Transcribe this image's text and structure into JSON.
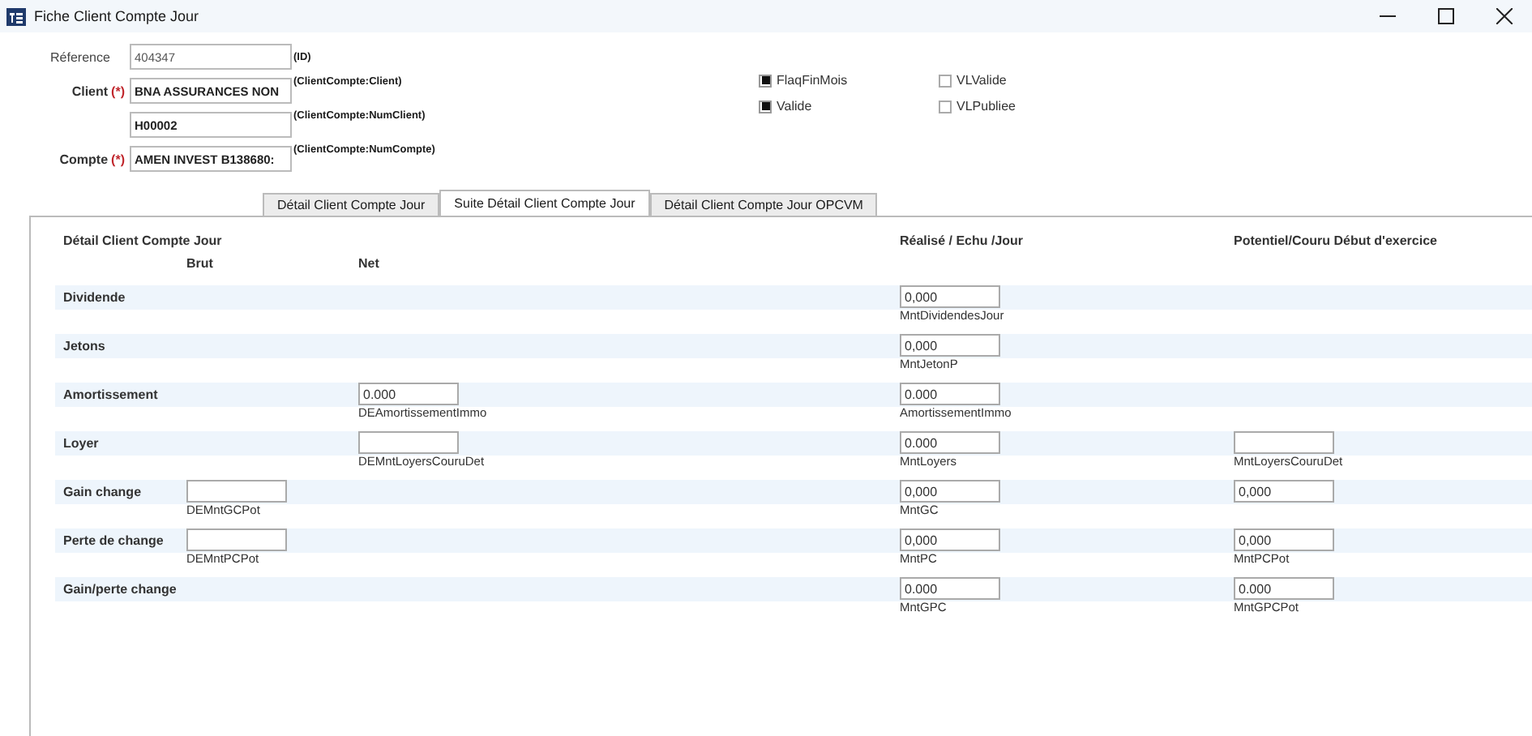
{
  "window": {
    "title": "Fiche Client Compte Jour"
  },
  "header_fields": [
    {
      "label": "Réference",
      "value": "404347",
      "tag": "(ID)"
    },
    {
      "label": "Client ",
      "required": "(*)",
      "value": "BNA ASSURANCES NON",
      "tag": "(ClientCompte:Client)"
    },
    {
      "value": "H00002",
      "tag": "(ClientCompte:NumClient)"
    },
    {
      "label": "Compte",
      "required": "(*)",
      "value": "AMEN INVEST B138680:",
      "tag": "(ClientCompte:NumCompte)"
    }
  ],
  "checkboxes": [
    {
      "label": "FlaqFinMois",
      "checked": true
    },
    {
      "label": "VLValide",
      "checked": false
    },
    {
      "label": "Valide",
      "checked": true
    },
    {
      "label": "VLPubliee",
      "checked": false
    }
  ],
  "tabs": [
    {
      "label": "Détail Client Compte Jour",
      "selected": false
    },
    {
      "label": "Suite Détail Client Compte Jour",
      "selected": true
    },
    {
      "label": "Détail Client Compte Jour OPCVM",
      "selected": false
    }
  ],
  "section_title": "Détail Client Compte Jour",
  "column_headers": {
    "brut": "Brut",
    "net": "Net",
    "realise": "Réalisé / Echu /Jour",
    "potentiel": "Potentiel/Couru Début d'exercice"
  },
  "rows": [
    {
      "label": "Dividende",
      "realise": {
        "value": "0,000",
        "caption": "MntDividendesJour"
      }
    },
    {
      "label": "Jetons",
      "realise": {
        "value": "0,000",
        "caption": "MntJetonP"
      }
    },
    {
      "label": "Amortissement",
      "net": {
        "value": "0.000",
        "caption": "DEAmortissementImmo"
      },
      "realise": {
        "value": "0.000",
        "caption": "AmortissementImmo"
      }
    },
    {
      "label": "Loyer",
      "net": {
        "caption": "DEMntLoyersCouruDet"
      },
      "realise": {
        "value": "0.000",
        "caption": "MntLoyers"
      },
      "potentiel": {
        "caption": "MntLoyersCouruDet"
      }
    },
    {
      "label": "Gain change",
      "brut": {
        "caption": "DEMntGCPot"
      },
      "realise": {
        "value": "0,000",
        "caption": "MntGC"
      },
      "potentiel": {
        "value": "0,000"
      }
    },
    {
      "label": "Perte de change",
      "brut": {
        "caption": "DEMntPCPot"
      },
      "realise": {
        "value": "0,000",
        "caption": "MntPC"
      },
      "potentiel": {
        "value": "0,000",
        "caption": "MntPCPot"
      }
    },
    {
      "label": "Gain/perte change",
      "realise": {
        "value": "0.000",
        "caption": "MntGPC"
      },
      "potentiel": {
        "value": "0.000",
        "caption": "MntGPCPot"
      }
    }
  ]
}
